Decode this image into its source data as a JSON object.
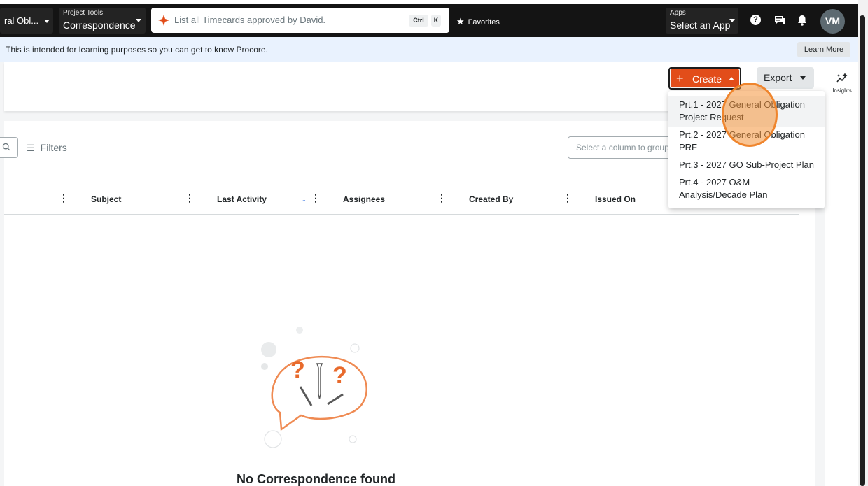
{
  "topnav": {
    "project_value": "ral Obl...",
    "tools_label": "Project Tools",
    "tools_value": "Correspondence",
    "search_placeholder": "List all Timecards approved by David.",
    "shortcut_ctrl": "Ctrl",
    "shortcut_key": "K",
    "favorites_label": "Favorites",
    "apps_label": "Apps",
    "apps_value": "Select an App",
    "avatar_initials": "VM"
  },
  "banner": {
    "text": "This is intended for learning purposes so you can get to know Procore.",
    "learn_more": "Learn More"
  },
  "header": {
    "create_label": "Create",
    "export_label": "Export",
    "insights_label": "Insights"
  },
  "create_menu": {
    "items": [
      {
        "label": "Prt.1 - 2027 General Obligation Project Request"
      },
      {
        "label": "Prt.2 - 2027 General Obligation PRF"
      },
      {
        "label": "Prt.3 - 2027 GO Sub-Project Plan"
      },
      {
        "label": "Prt.4 - 2027 O&M Analysis/Decade Plan"
      }
    ]
  },
  "toolbar": {
    "filters_label": "Filters",
    "group_placeholder": "Select a column to group"
  },
  "table": {
    "columns": [
      {
        "label": ""
      },
      {
        "label": "Subject"
      },
      {
        "label": "Last Activity"
      },
      {
        "label": "Assignees"
      },
      {
        "label": "Created By"
      },
      {
        "label": "Issued On"
      }
    ]
  },
  "empty_state": {
    "title": "No Correspondence found"
  },
  "colors": {
    "brand_orange": "#e24d1a",
    "nav_dark": "#141414",
    "banner_blue": "#e9f2fe",
    "sort_blue": "#2066df"
  }
}
